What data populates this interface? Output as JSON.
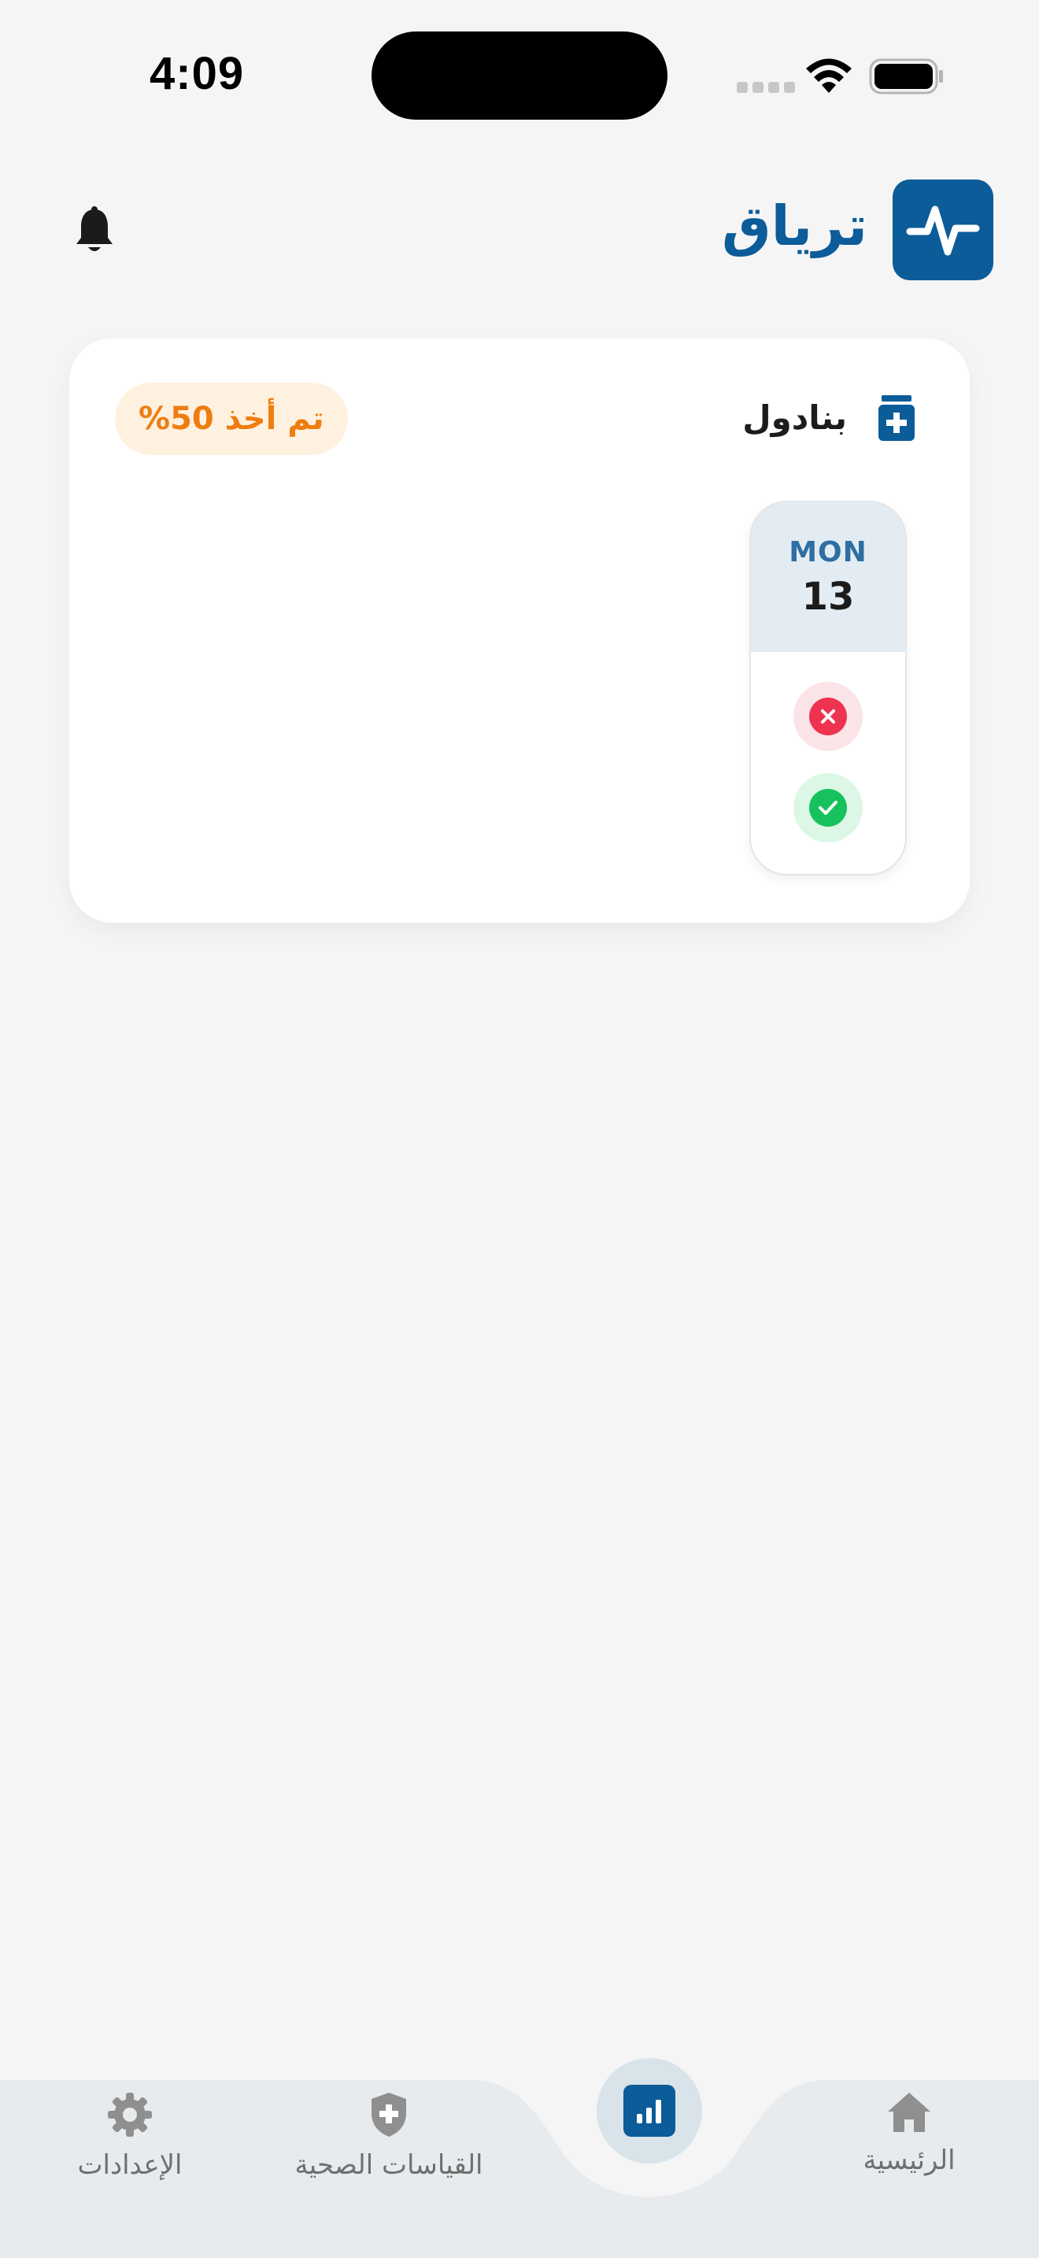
{
  "status_bar": {
    "time": "4:09"
  },
  "header": {
    "app_title": "ترياق",
    "logo_icon": "pulse-icon",
    "notification_icon": "bell-icon"
  },
  "medication_card": {
    "name": "بنادول",
    "icon": "medicine-bottle-icon",
    "taken_badge": "تم أخذ 50%",
    "taken_percent": 50,
    "day": {
      "name": "MON",
      "number": "13",
      "doses": [
        {
          "status": "missed",
          "icon": "x-circle-icon"
        },
        {
          "status": "taken",
          "icon": "check-circle-icon"
        }
      ]
    }
  },
  "bottom_nav": {
    "items": [
      {
        "label": "الرئيسية",
        "icon": "home-icon"
      },
      {
        "label": "القياسات الصحية",
        "icon": "shield-plus-icon"
      },
      {
        "label": "الإعدادات",
        "icon": "gear-icon"
      }
    ],
    "center_icon": "chart-icon"
  },
  "colors": {
    "primary": "#0b5c99",
    "badge_text": "#ee7d10",
    "badge_bg": "#fff1e0",
    "missed": "#ee3350",
    "taken": "#15c25b",
    "background": "#f5f5f5"
  }
}
